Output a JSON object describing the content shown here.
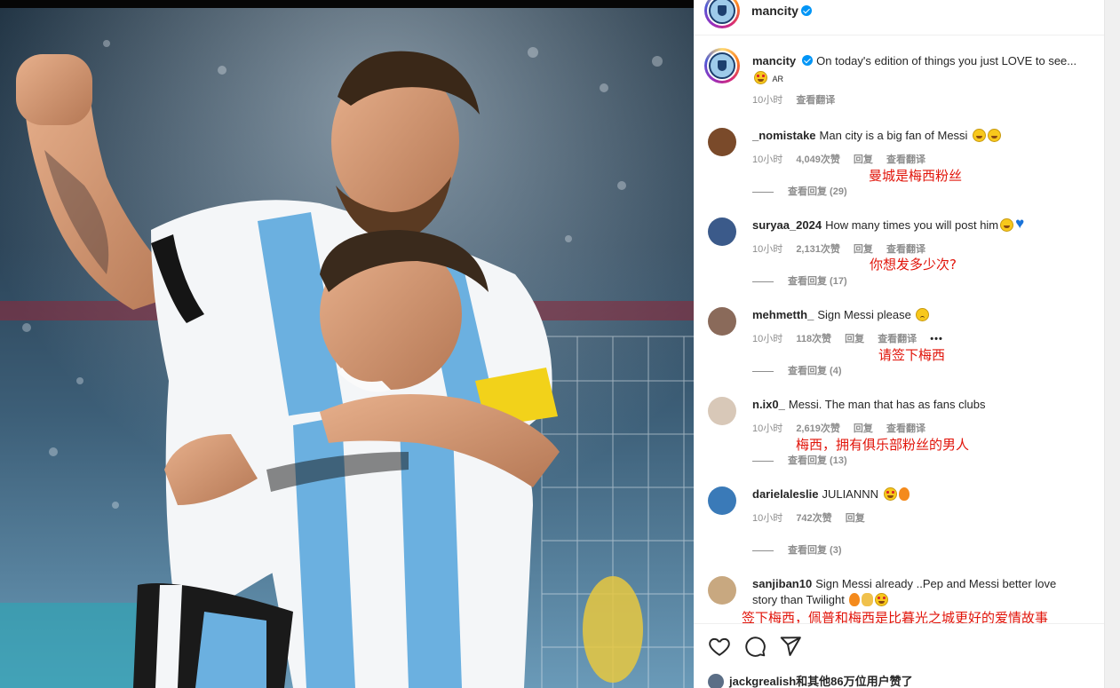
{
  "post": {
    "account": "mancity",
    "caption_username": "mancity",
    "caption_text": "On today's edition of things you just LOVE to see...",
    "caption_suffix": "AR",
    "caption_time": "10小时",
    "caption_translate": "查看翻译"
  },
  "comments": [
    {
      "username": "_nomistake",
      "text": "Man city is a big fan of Messi",
      "emojis": [
        "laugh",
        "laugh"
      ],
      "time": "10小时",
      "likes": "4,049次赞",
      "reply": "回复",
      "translate": "查看翻译",
      "view_replies": "查看回复 (29)",
      "annotation": "曼城是梅西粉丝",
      "avatar_color": "#7a4a2a"
    },
    {
      "username": "suryaa_2024",
      "text": "How many times you will post him",
      "emojis": [
        "laugh",
        "heart"
      ],
      "time": "10小时",
      "likes": "2,131次赞",
      "reply": "回复",
      "translate": "查看翻译",
      "view_replies": "查看回复 (17)",
      "annotation": "你想发多少次?",
      "avatar_color": "#3b5a8a"
    },
    {
      "username": "mehmetth_",
      "text": "Sign Messi please",
      "emojis": [
        "sad"
      ],
      "time": "10小时",
      "likes": "118次赞",
      "reply": "回复",
      "translate": "查看翻译",
      "more": "•••",
      "view_replies": "查看回复 (4)",
      "annotation": "请签下梅西",
      "avatar_color": "#8a6a5a"
    },
    {
      "username": "n.ix0_",
      "text": "Messi. The man that has as fans clubs",
      "emojis": [],
      "time": "10小时",
      "likes": "2,619次赞",
      "reply": "回复",
      "translate": "查看翻译",
      "view_replies": "查看回复 (13)",
      "annotation": "梅西，拥有俱乐部粉丝的男人",
      "avatar_color": "#d8c8b8"
    },
    {
      "username": "darielaleslie",
      "text": "JULIANNN",
      "emojis": [
        "star",
        "fire"
      ],
      "time": "10小时",
      "likes": "742次赞",
      "reply": "回复",
      "view_replies": "查看回复 (3)",
      "avatar_color": "#3a7ab8"
    },
    {
      "username": "sanjiban10",
      "text": "Sign Messi already ..Pep and Messi better love story than Twilight",
      "emojis": [
        "fire",
        "clap",
        "star"
      ],
      "annotation": "签下梅西，佩普和梅西是比暮光之城更好的爱情故事",
      "avatar_color": "#c8a880"
    }
  ],
  "likes_line": {
    "user": "jackgrealish",
    "rest": "和其他86万位用户赞了"
  },
  "icons": [
    "heart-icon",
    "comment-icon",
    "share-icon",
    "more-icon",
    "verified-icon"
  ]
}
